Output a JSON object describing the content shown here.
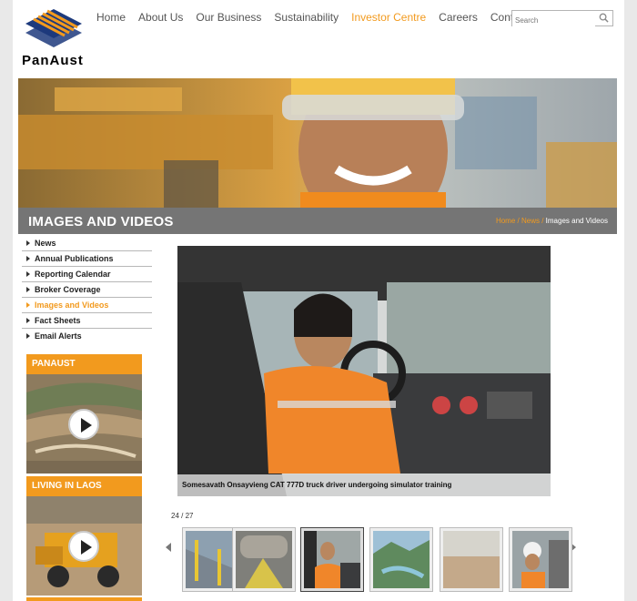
{
  "brand": {
    "name": "PanAust",
    "logo_text": "PanAust",
    "accent": "#f29a1e",
    "logo_blue": "#1d3a7c"
  },
  "nav": {
    "items": [
      {
        "label": "Home",
        "active": false
      },
      {
        "label": "About Us",
        "active": false
      },
      {
        "label": "Our Business",
        "active": false
      },
      {
        "label": "Sustainability",
        "active": false
      },
      {
        "label": "Investor Centre",
        "active": true
      },
      {
        "label": "Careers",
        "active": false
      },
      {
        "label": "Contact Us",
        "active": false
      }
    ]
  },
  "search": {
    "placeholder": "Search",
    "icon": "search-icon"
  },
  "page_title": "IMAGES AND VIDEOS",
  "breadcrumb": {
    "home": "Home",
    "sep1": " / ",
    "news": "News",
    "sep2": " / ",
    "current": "Images and Videos"
  },
  "sidebar": {
    "items": [
      {
        "label": "News",
        "active": false
      },
      {
        "label": "Annual Publications",
        "active": false
      },
      {
        "label": "Reporting Calendar",
        "active": false
      },
      {
        "label": "Broker Coverage",
        "active": false
      },
      {
        "label": "Images and Videos",
        "active": true
      },
      {
        "label": "Fact Sheets",
        "active": false
      },
      {
        "label": "Email Alerts",
        "active": false
      }
    ]
  },
  "videos": [
    {
      "title": "PANAUST"
    },
    {
      "title": "LIVING IN LAOS"
    }
  ],
  "gallery": {
    "caption": "Somesavath Onsayvieng CAT 777D truck driver undergoing simulator training",
    "counter": "24 / 27",
    "current_index": 24,
    "total": 27,
    "thumbnails": [
      "mine-walkway",
      "conveyor-plant",
      "simulator-driver",
      "river-valley",
      "open-plain",
      "hardhat-worker"
    ],
    "active_thumbnail": 2
  }
}
